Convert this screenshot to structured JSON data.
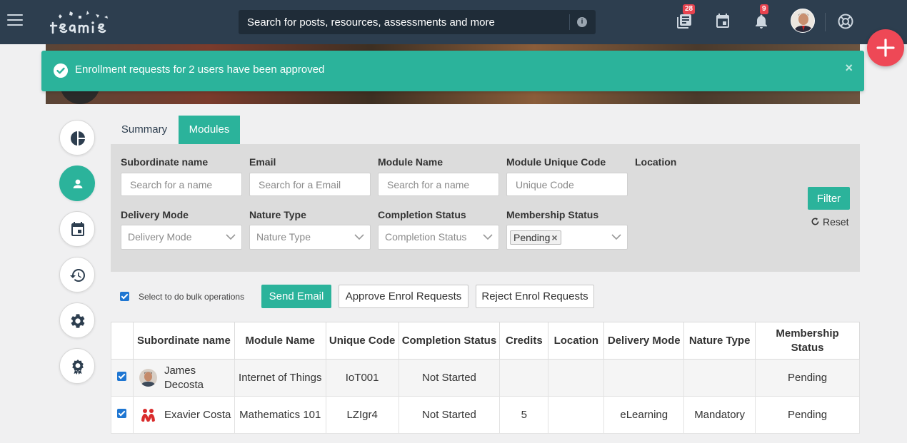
{
  "header": {
    "search_placeholder": "Search for posts, resources, assessments and more",
    "library_badge": "28",
    "notifications_badge": "9"
  },
  "toast": {
    "message": "Enrollment requests for 2 users have been approved",
    "close": "×"
  },
  "tabs": [
    {
      "label": "Summary",
      "active": false
    },
    {
      "label": "Modules",
      "active": true
    }
  ],
  "filters": {
    "subordinate_name": {
      "label": "Subordinate name",
      "placeholder": "Search for a name"
    },
    "email": {
      "label": "Email",
      "placeholder": "Search for a Email"
    },
    "module_name": {
      "label": "Module Name",
      "placeholder": "Search for a name"
    },
    "module_code": {
      "label": "Module Unique Code",
      "placeholder": "Unique Code"
    },
    "location": {
      "label": "Location"
    },
    "delivery_mode": {
      "label": "Delivery Mode",
      "placeholder": "Delivery Mode"
    },
    "nature_type": {
      "label": "Nature Type",
      "placeholder": "Nature Type"
    },
    "completion_status": {
      "label": "Completion Status",
      "placeholder": "Completion Status"
    },
    "membership_status": {
      "label": "Membership Status",
      "selected_tag": "Pending"
    },
    "filter_button": "Filter",
    "reset_button": "Reset"
  },
  "bulk": {
    "checkbox_label": "Select to do bulk operations",
    "send_email": "Send Email",
    "approve": "Approve Enrol Requests",
    "reject": "Reject Enrol Requests"
  },
  "table": {
    "columns": {
      "subordinate": "Subordinate name",
      "module": "Module Name",
      "code": "Unique Code",
      "completion": "Completion Status",
      "credits": "Credits",
      "location": "Location",
      "delivery": "Delivery Mode",
      "nature": "Nature Type",
      "membership": "Membership Status"
    },
    "rows": [
      {
        "name": "James Decosta",
        "module": "Internet of Things",
        "code": "IoT001",
        "completion": "Not Started",
        "credits": "",
        "location": "",
        "delivery": "",
        "nature": "",
        "membership": "Pending"
      },
      {
        "name": "Exavier Costa",
        "module": "Mathematics 101",
        "code": "LZIgr4",
        "completion": "Not Started",
        "credits": "5",
        "location": "",
        "delivery": "eLearning",
        "nature": "Mandatory",
        "membership": "Pending"
      }
    ]
  },
  "colors": {
    "accent": "#2bb39b",
    "topbar": "#2d3e4f",
    "badge": "#e8434f",
    "fab": "#ee4856"
  }
}
